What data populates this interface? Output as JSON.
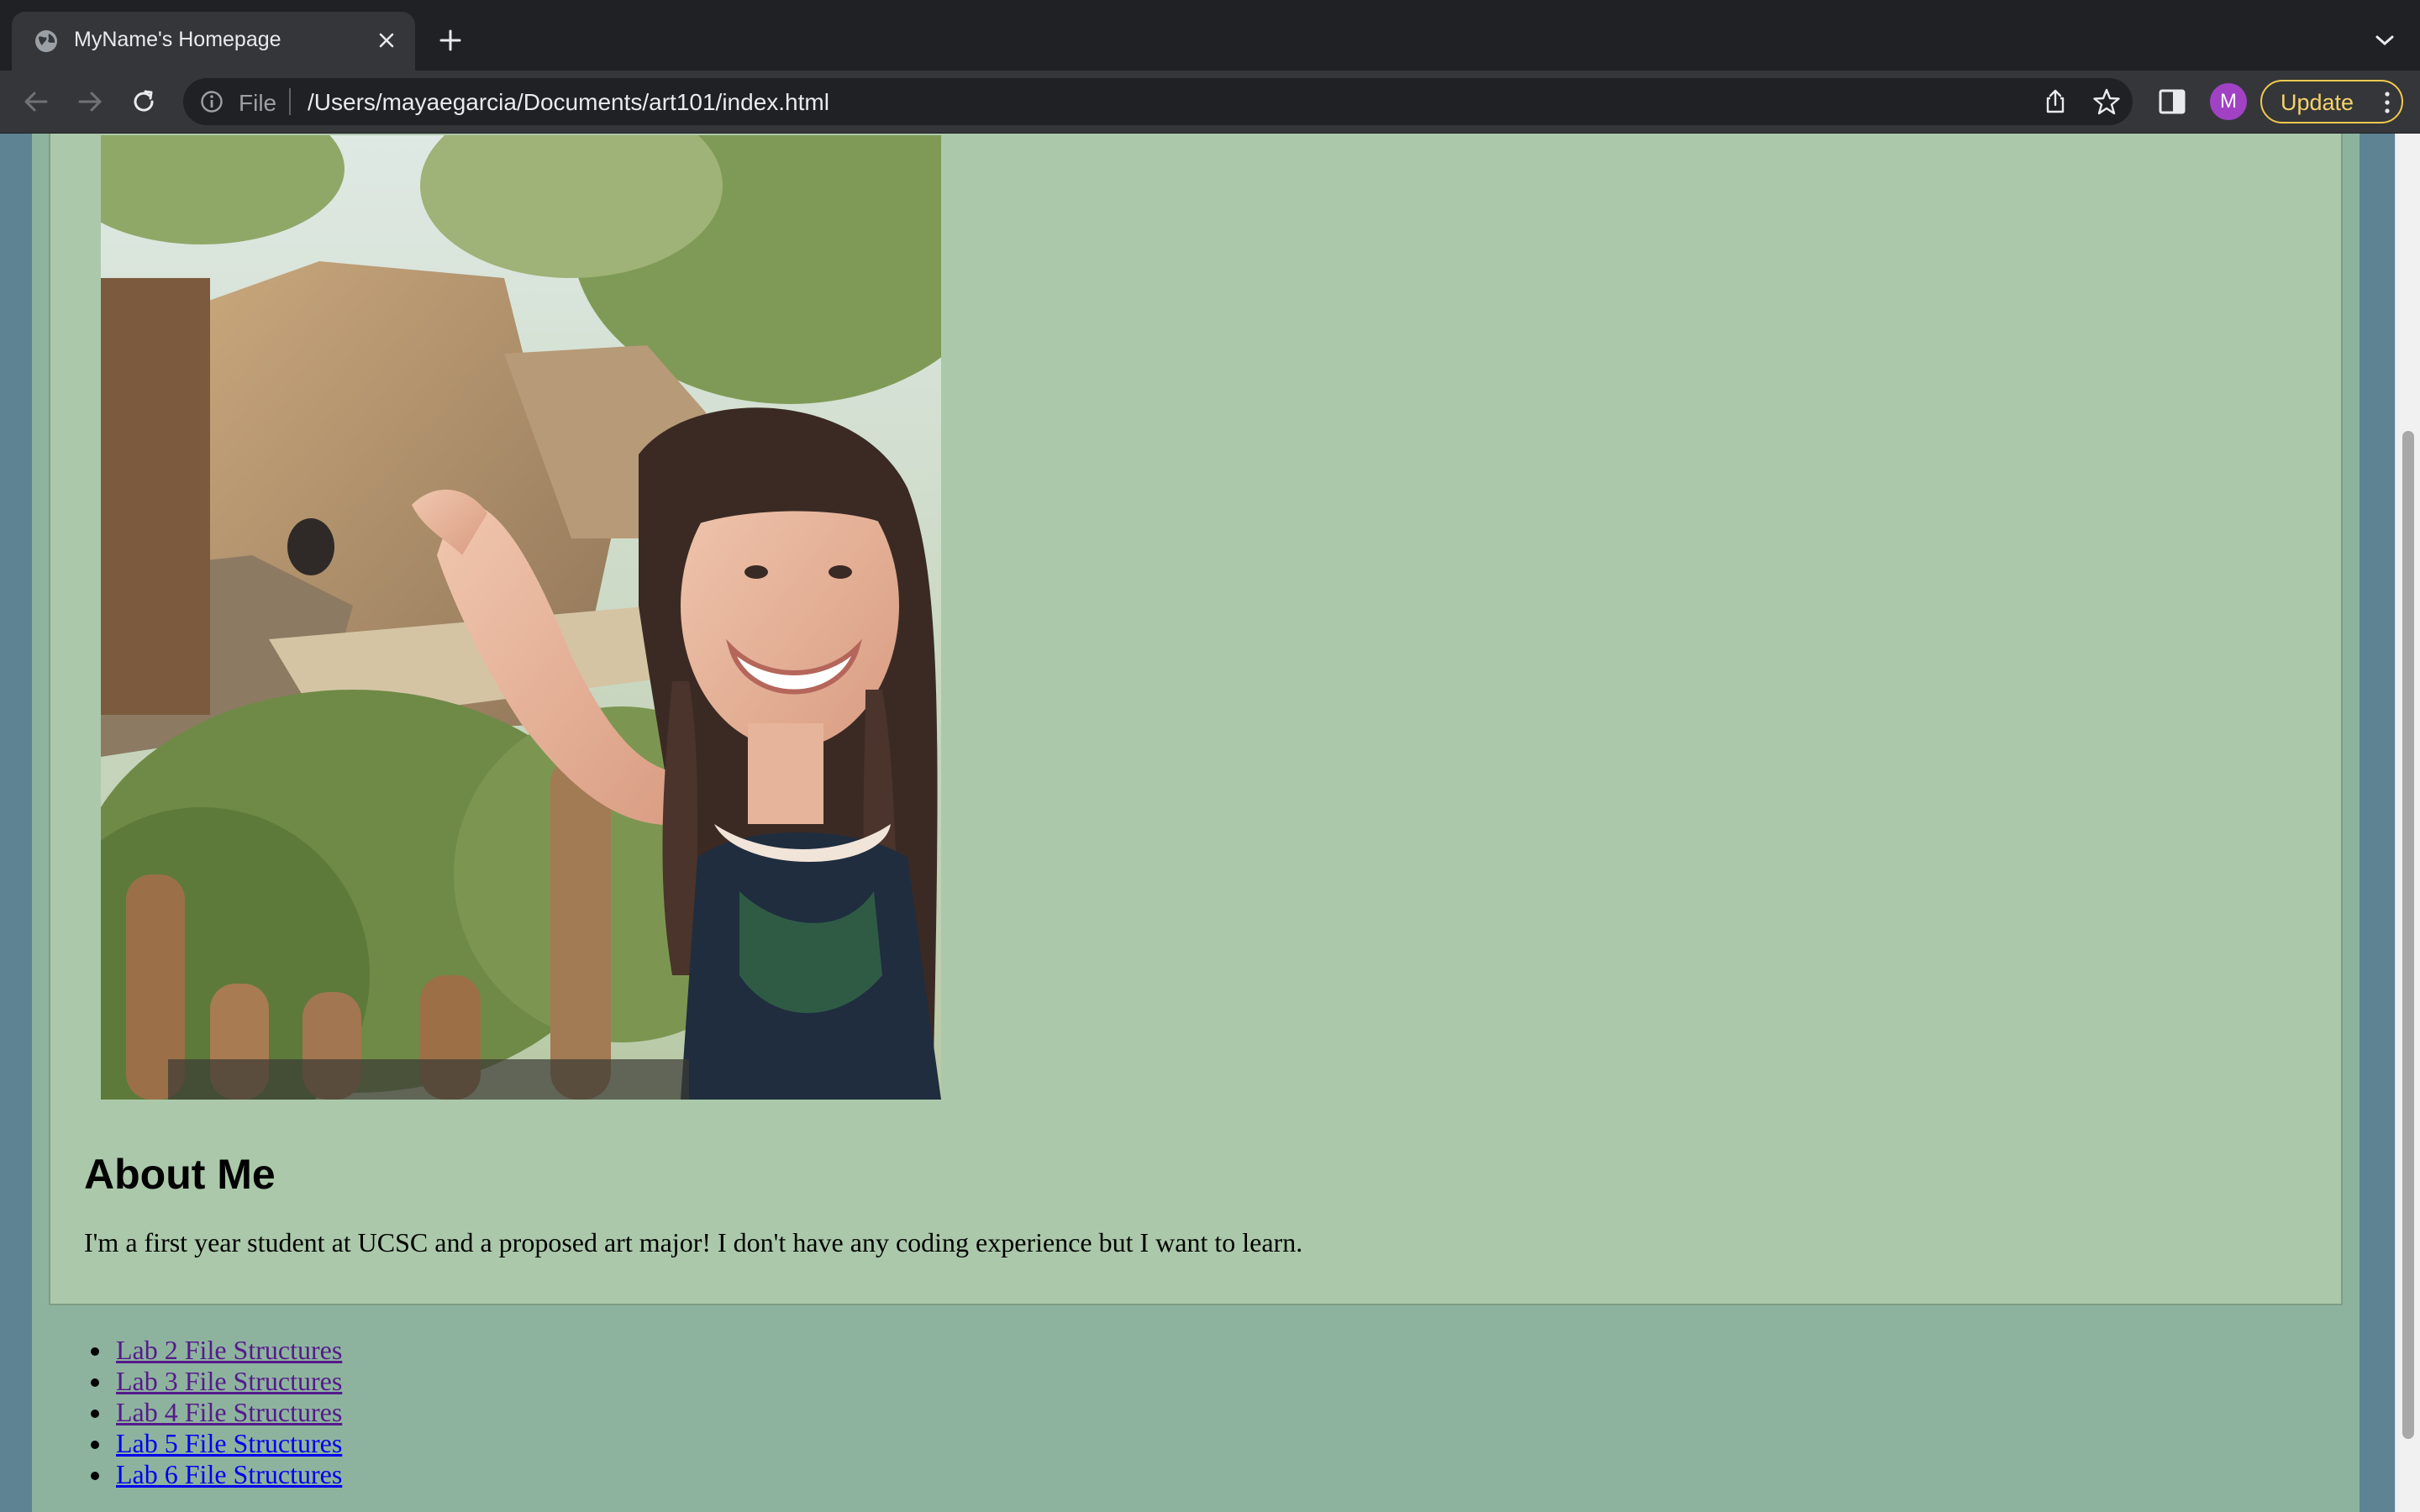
{
  "browser": {
    "tab_title": "MyName's Homepage",
    "url_scheme": "File",
    "url": "/Users/mayaegarcia/Documents/art101/index.html",
    "avatar_initial": "M",
    "update_label": "Update",
    "icons": [
      "globe-icon",
      "close-icon",
      "plus-icon",
      "chevron-down-icon",
      "back-arrow-icon",
      "forward-arrow-icon",
      "reload-icon",
      "info-icon",
      "share-icon",
      "star-icon",
      "side-panel-icon",
      "kebab-menu-icon"
    ],
    "colors": {
      "chrome_dark": "#202124",
      "chrome_mid": "#35363a",
      "avatar": "#a142c5",
      "update_border": "#f2c94c"
    }
  },
  "page": {
    "photo_alt": "Photo of Maya at the zoo",
    "about_heading": "About Me",
    "about_text": "I'm a first year student at UCSC and a proposed art major! I don't have any coding experience but I want to learn.",
    "links": [
      {
        "label": "Lab 2 File Structures",
        "state": "visited"
      },
      {
        "label": "Lab 3 File Structures",
        "state": "visited"
      },
      {
        "label": "Lab 4 File Structures",
        "state": "visited"
      },
      {
        "label": "Lab 5 File Structures",
        "state": "unvisited"
      },
      {
        "label": "Lab 6 File Structures",
        "state": "unvisited"
      }
    ],
    "colors": {
      "outer_bg": "#5e8393",
      "page_bg": "#8db39e",
      "card_bg": "#abc9aa",
      "visited_link": "#551a8b",
      "link": "#0000ee"
    }
  }
}
